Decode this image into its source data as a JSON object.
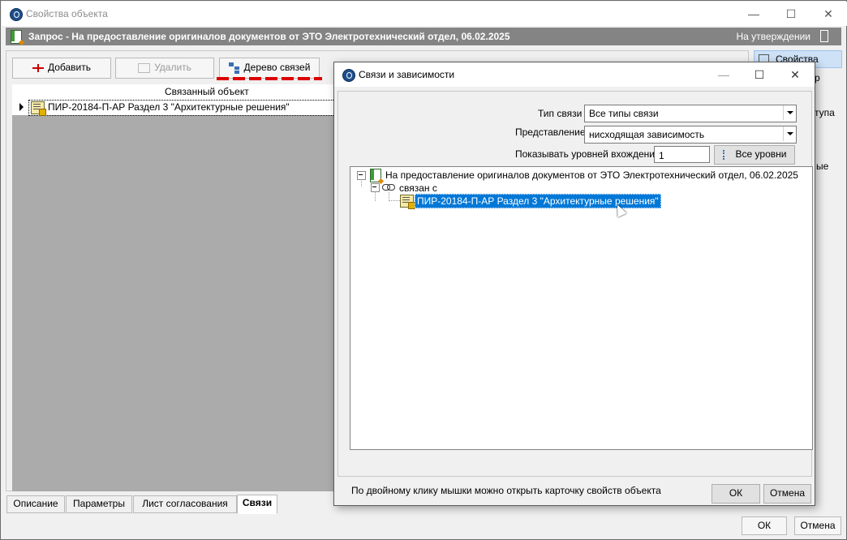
{
  "window": {
    "title": "Свойства объекта",
    "controls": [
      "minimize",
      "maximize",
      "close"
    ]
  },
  "docbar": {
    "title": "Запрос - На предоставление оригиналов документов от ЭТО Электротехнический отдел, 06.02.2025",
    "status": "На утверждении"
  },
  "toolbar": {
    "add": "Добавить",
    "delete": "Удалить",
    "tree": "Дерево связей"
  },
  "grid": {
    "header": "Связанный объект",
    "rows": [
      {
        "text": "ПИР-20184-П-АР Раздел 3 \"Архитектурные решения\""
      }
    ]
  },
  "tabs": [
    {
      "label": "Описание"
    },
    {
      "label": "Параметры"
    },
    {
      "label": "Лист согласования"
    },
    {
      "label": "Связи",
      "active": true
    }
  ],
  "right_side": {
    "item1": "Свойства",
    "item2": "р",
    "item3": "ступа",
    "item4": "ые"
  },
  "footer": {
    "ok": "ОК",
    "cancel": "Отмена"
  },
  "dialog": {
    "title": "Связи и зависимости",
    "link_type_label": "Тип связи",
    "link_type_value": "Все типы связи",
    "view_label": "Представление",
    "view_value": "нисходящая зависимость",
    "levels_label": "Показывать уровней вхождения",
    "levels_value": "1",
    "all_levels": "Все уровни",
    "tree": {
      "root": "На предоставление оригиналов документов от ЭТО Электротехнический отдел, 06.02.2025",
      "relation": "связан с",
      "child": "ПИР-20184-П-АР Раздел 3 \"Архитектурные решения\""
    },
    "hint": "По двойному клику мышки можно открыть карточку свойств объекта",
    "ok": "ОК",
    "cancel": "Отмена"
  },
  "colors": {
    "selection": "#0078d7",
    "docbar": "#848484",
    "annotation": "#dd0000"
  }
}
